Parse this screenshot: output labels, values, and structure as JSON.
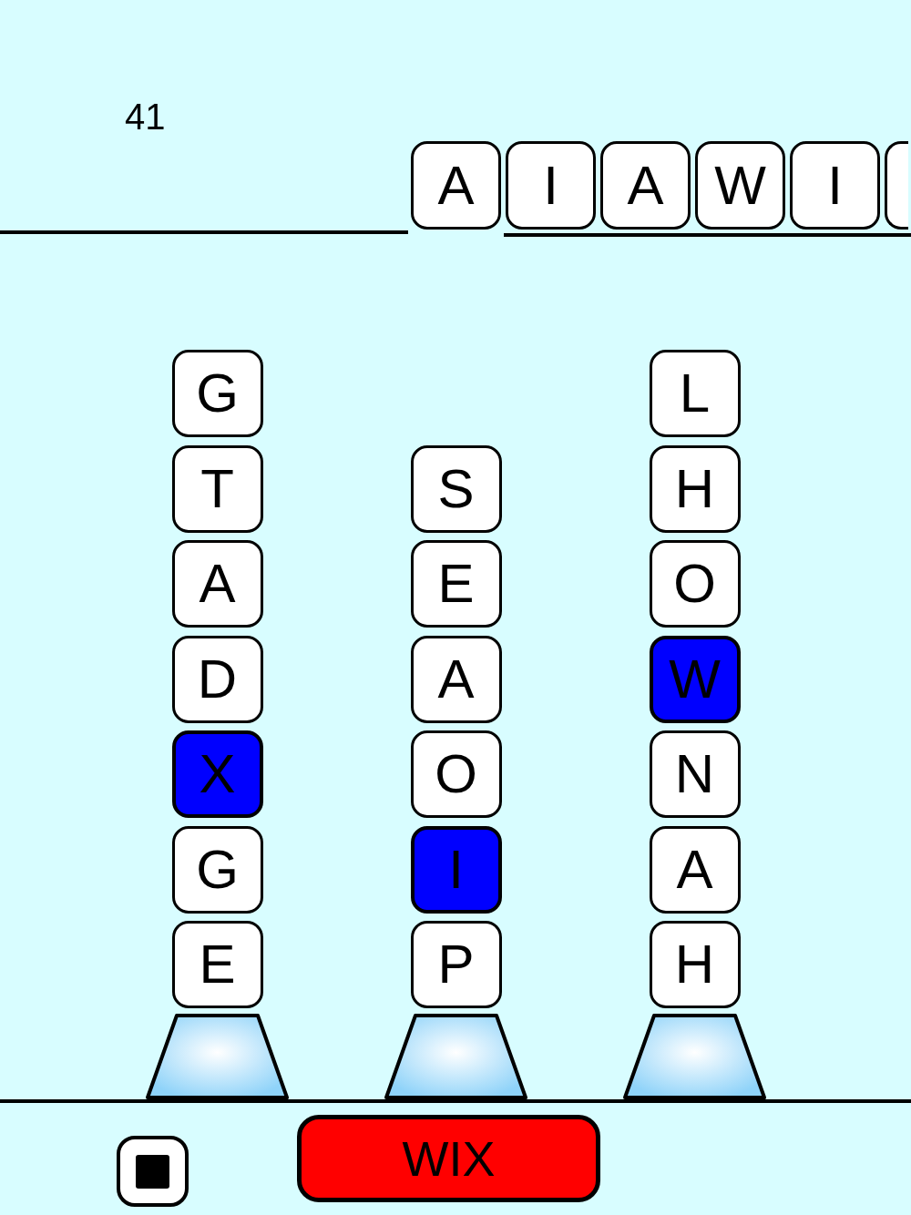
{
  "score": "41",
  "word_tiles": [
    {
      "kind": "letter",
      "letter": "A"
    },
    {
      "kind": "letter",
      "letter": "I"
    },
    {
      "kind": "letter",
      "letter": "A"
    },
    {
      "kind": "letter",
      "letter": "W"
    },
    {
      "kind": "letter",
      "letter": "I"
    },
    {
      "kind": "partial"
    }
  ],
  "columns": [
    {
      "tiles": [
        {
          "letter": "G",
          "selected": false
        },
        {
          "letter": "T",
          "selected": false
        },
        {
          "letter": "A",
          "selected": false
        },
        {
          "letter": "D",
          "selected": false
        },
        {
          "letter": "X",
          "selected": true
        },
        {
          "letter": "G",
          "selected": false
        },
        {
          "letter": "E",
          "selected": false
        }
      ]
    },
    {
      "tiles": [
        {
          "letter": "S",
          "selected": false
        },
        {
          "letter": "E",
          "selected": false
        },
        {
          "letter": "A",
          "selected": false
        },
        {
          "letter": "O",
          "selected": false
        },
        {
          "letter": "I",
          "selected": true
        },
        {
          "letter": "P",
          "selected": false
        }
      ]
    },
    {
      "tiles": [
        {
          "letter": "L",
          "selected": false
        },
        {
          "letter": "H",
          "selected": false
        },
        {
          "letter": "O",
          "selected": false
        },
        {
          "letter": "W",
          "selected": true
        },
        {
          "letter": "N",
          "selected": false
        },
        {
          "letter": "A",
          "selected": false
        },
        {
          "letter": "H",
          "selected": false
        }
      ]
    }
  ],
  "action_button": {
    "label": "WIX"
  }
}
